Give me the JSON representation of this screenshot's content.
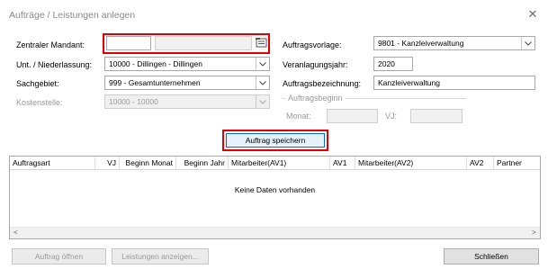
{
  "window": {
    "title": "Aufträge / Leistungen anlegen",
    "close_label": "✕"
  },
  "form": {
    "mandant_label": "Zentraler Mandant:",
    "mandant_number": "",
    "mandant_name": "",
    "niederlassung_label": "Unt. / Niederlassung:",
    "niederlassung_value": "10000 - Dillingen - Dillingen",
    "sachgebiet_label": "Sachgebiet:",
    "sachgebiet_value": "999 - Gesamtunternehmen",
    "kostenstelle_label": "Kostenstelle:",
    "kostenstelle_value": "10000 - 10000",
    "auftragsvorlage_label": "Auftragsvorlage:",
    "auftragsvorlage_value": "9801 - Kanzleiverwaltung",
    "veranlagungsjahr_label": "Veranlagungsjahr:",
    "veranlagungsjahr_value": "2020",
    "auftragsbezeichnung_label": "Auftragsbezeichnung:",
    "auftragsbezeichnung_value": "Kanzleiverwaltung",
    "auftragsbeginn_label": "Auftragsbeginn",
    "monat_label": "Monat:",
    "monat_value": "",
    "vj_label": "VJ:",
    "vj_value": ""
  },
  "buttons": {
    "save": "Auftrag speichern",
    "open": "Auftrag öffnen",
    "leistungen": "Leistungen anzeigen...",
    "close": "Schließen"
  },
  "grid": {
    "columns": [
      "Auftragsart",
      "VJ",
      "Beginn Monat",
      "Beginn Jahr",
      "Mitarbeiter(AV1)",
      "AV1",
      "Mitarbeiter(AV2)",
      "AV2",
      "Partner"
    ],
    "empty_text": "Keine Daten vorhanden",
    "scroll_left": "<",
    "scroll_right": ">"
  },
  "icons": {
    "lookup": "lookup-icon",
    "dropdown": "chevron-down-icon"
  },
  "colors": {
    "highlight": "#e00000",
    "focus": "#0a64d8"
  }
}
